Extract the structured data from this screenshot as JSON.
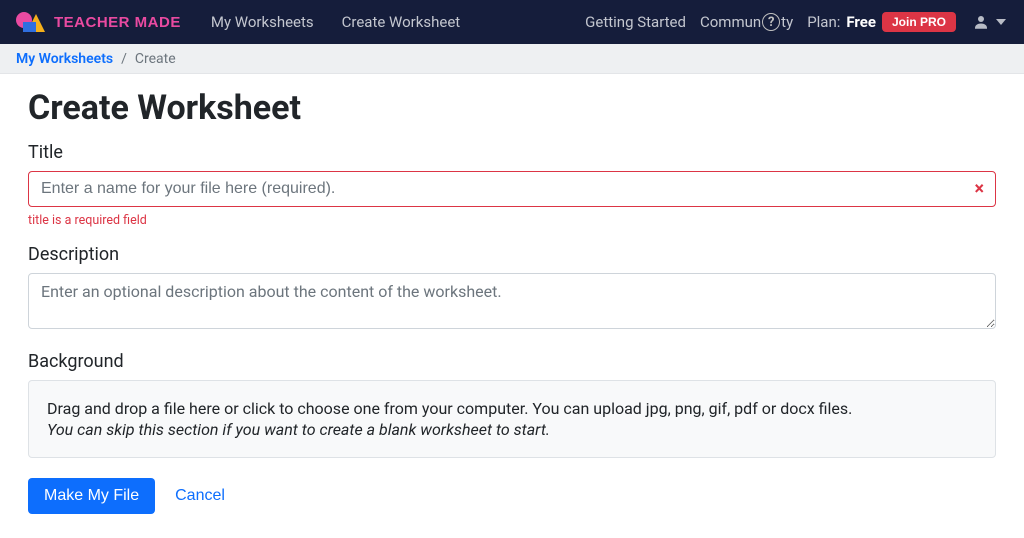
{
  "brand": {
    "name": "TEACHER MADE"
  },
  "nav": {
    "links": [
      "My Worksheets",
      "Create Worksheet"
    ],
    "getting_started": "Getting Started",
    "community_prefix": "Commun",
    "community_suffix": "ty",
    "question_mark": "?",
    "plan_label": "Plan:",
    "plan_value": "Free",
    "join_pro": "Join PRO"
  },
  "breadcrumb": {
    "parent": "My Worksheets",
    "separator": "/",
    "current": "Create"
  },
  "page": {
    "title": "Create Worksheet",
    "title_label": "Title",
    "title_placeholder": "Enter a name for your file here (required).",
    "title_error": "title is a required field",
    "description_label": "Description",
    "description_placeholder": "Enter an optional description about the content of the worksheet.",
    "background_label": "Background",
    "dropzone_text": "Drag and drop a file here or click to choose one from your computer. You can upload jpg, png, gif, pdf or docx files.",
    "dropzone_hint": "You can skip this section if you want to create a blank worksheet to start.",
    "submit": "Make My File",
    "cancel": "Cancel",
    "clear_icon": "×"
  }
}
